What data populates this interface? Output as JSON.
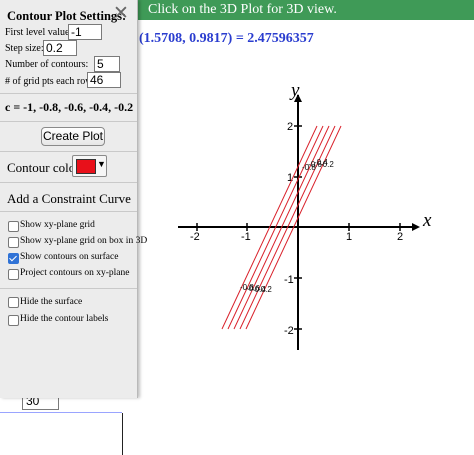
{
  "banner": {
    "text": "Click on the 3D Plot for 3D view."
  },
  "readout": {
    "text": "(1.5708, 0.9817) = 2.47596357"
  },
  "settings": {
    "title": "Contour Plot Settings:",
    "close_glyph": "✕",
    "first_level_label": "First level value:",
    "first_level_value": "-1",
    "step_label": "Step size:",
    "step_value": "0.2",
    "contours_label": "Number of contours:",
    "contours_value": "5",
    "grid_label": "# of grid pts each row:",
    "grid_value": "46",
    "levels_text": "c = -1, -0.8, -0.6, -0.4, -0.2",
    "create_button": "Create Plot",
    "contour_color_label": "Contour color:",
    "contour_color": "#e8101a",
    "constraint_label": "Add a Constraint Curve",
    "options": [
      {
        "label": "Show xy-plane grid",
        "checked": false
      },
      {
        "label": "Show xy-plane grid on box in 3D",
        "checked": false
      },
      {
        "label": "Show contours on surface",
        "checked": true
      },
      {
        "label": "Project contours on xy-plane",
        "checked": false
      },
      {
        "label": "Hide the surface",
        "checked": false
      },
      {
        "label": "Hide the contour labels",
        "checked": false
      }
    ]
  },
  "below_panel": {
    "value": "30"
  },
  "plot": {
    "x_axis_label": "x",
    "y_axis_label": "y",
    "x_ticks": [
      "-2",
      "-1",
      "1",
      "2"
    ],
    "y_ticks": [
      "2",
      "1",
      "-1",
      "-2"
    ],
    "contour_labels_upper": [
      "-0.8",
      "-0.6",
      "-0.4",
      "-0.2"
    ],
    "contour_labels_lower": [
      "-0.8",
      "-0.6",
      "-0.4",
      "-0.2"
    ],
    "curve_color": "#d9202a"
  }
}
